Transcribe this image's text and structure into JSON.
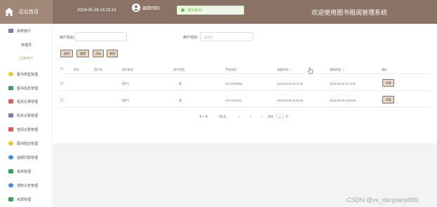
{
  "header": {
    "home_label": "后台首页",
    "datetime": "2024-05-28 14:23:15",
    "username": "admin",
    "toast": "退出成功!",
    "site_title": "欢迎使用图书租阅管理系统"
  },
  "sidebar": {
    "items": [
      {
        "label": "系统用户",
        "icon_color": "#8f6fb8"
      },
      {
        "label": "图书类型管理",
        "icon_color": "#f0c419"
      },
      {
        "label": "图书信息管理",
        "icon_color": "#35a35c"
      },
      {
        "label": "租赁记录管理",
        "icon_color": "#e05a5a"
      },
      {
        "label": "购买记录管理",
        "icon_color": "#8f6fb8"
      },
      {
        "label": "借阅记录管理",
        "icon_color": "#e05a5a"
      },
      {
        "label": "图书借还管理",
        "icon_color": "#f0c419"
      },
      {
        "label": "逾期罚款管理",
        "icon_color": "#3d8ad9"
      },
      {
        "label": "系统管理",
        "icon_color": "#35a35c"
      },
      {
        "label": "通知公告管理",
        "icon_color": "#3d8ad9"
      },
      {
        "label": "资源管理",
        "icon_color": "#35a35c"
      }
    ],
    "sub_items": [
      {
        "label": "管理员",
        "active": false
      },
      {
        "label": "注册用户",
        "active": true
      }
    ]
  },
  "search": {
    "name_label": "用户姓名:",
    "gender_label": "用户性别:",
    "gender_placeholder": "请选择"
  },
  "buttons": {
    "search": "查询",
    "reset": "重置",
    "add": "添加",
    "delete": "删除"
  },
  "table": {
    "headers": [
      "序号",
      "用户名",
      "用户姓名",
      "用户性别",
      "手机号码",
      "创建时间",
      "更新时间",
      "操作"
    ],
    "rows": [
      {
        "index": "",
        "username": "",
        "name": "用户2",
        "gender": "女",
        "phone": "13712342566",
        "created": "2024-05-28 14:12:33",
        "updated": "2024-05-28 14:13:31",
        "action": "详情"
      },
      {
        "index": "",
        "username": "",
        "name": "用户1",
        "gender": "男",
        "phone": "13712341111",
        "created": "2024-05-28 12:53:02",
        "updated": "2024-05-28 12:53:02",
        "action": "详情"
      }
    ]
  },
  "pagination": {
    "total": "共 2 条",
    "page_size": "7条/页",
    "prev": "<",
    "current": "1",
    "next": ">",
    "goto_label": "前往",
    "goto_value": "1",
    "page_suffix": "页"
  },
  "watermark": "CSDN @vx_danpianji889"
}
